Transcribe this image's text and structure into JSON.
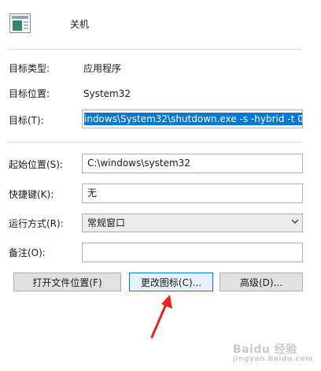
{
  "header": {
    "name": "关机",
    "icon": "shortcut-icon"
  },
  "properties": {
    "target_type_label": "目标类型:",
    "target_type_value": "应用程序",
    "target_location_label": "目标位置:",
    "target_location_value": "System32",
    "target_label": "目标(T):",
    "target_value": "indows\\System32\\shutdown.exe -s -hybrid -t 0",
    "start_in_label": "起始位置(S):",
    "start_in_value": "C:\\windows\\system32",
    "shortcut_key_label": "快捷键(K):",
    "shortcut_key_value": "无",
    "run_label": "运行方式(R):",
    "run_value": "常规窗口",
    "comment_label": "备注(O):",
    "comment_value": ""
  },
  "buttons": {
    "open_location": "打开文件位置(F)",
    "change_icon": "更改图标(C)...",
    "advanced": "高级(D)..."
  },
  "annotation": {
    "arrow_color": "#e8241d"
  },
  "watermark": {
    "text": "Baidu 经验",
    "sub": "jingyan.baidu.com"
  }
}
